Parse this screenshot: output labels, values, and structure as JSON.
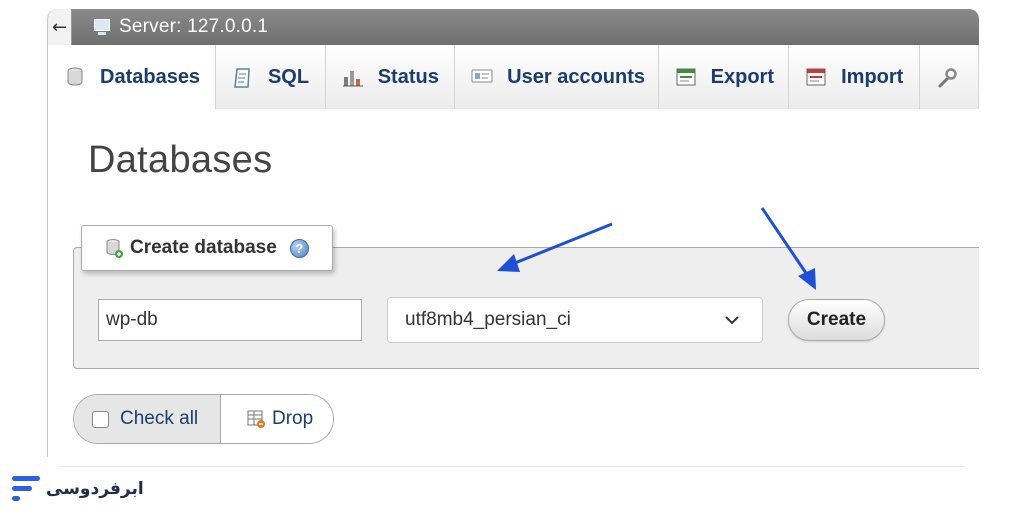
{
  "window": {
    "back_glyph": "←",
    "title": "Server: 127.0.0.1"
  },
  "tabs": [
    {
      "label": "Databases",
      "icon": "database-icon",
      "active": true
    },
    {
      "label": "SQL",
      "icon": "sql-icon",
      "active": false
    },
    {
      "label": "Status",
      "icon": "status-chart-icon",
      "active": false
    },
    {
      "label": "User accounts",
      "icon": "user-accounts-icon",
      "active": false
    },
    {
      "label": "Export",
      "icon": "export-icon",
      "active": false
    },
    {
      "label": "Import",
      "icon": "import-icon",
      "active": false
    },
    {
      "label": "",
      "icon": "wrench-icon",
      "active": false
    }
  ],
  "main": {
    "page_title": "Databases",
    "create_database": {
      "legend": "Create database",
      "help_glyph": "?",
      "name_value": "wp-db",
      "collation_value": "utf8mb4_persian_ci",
      "create_label": "Create"
    },
    "check_all_label": "Check all",
    "drop_label": "Drop"
  },
  "annotations": {
    "arrow_color": "#1f4fd6"
  },
  "brand": {
    "name": "ابرفردوسی",
    "color": "#2f5fe3"
  }
}
